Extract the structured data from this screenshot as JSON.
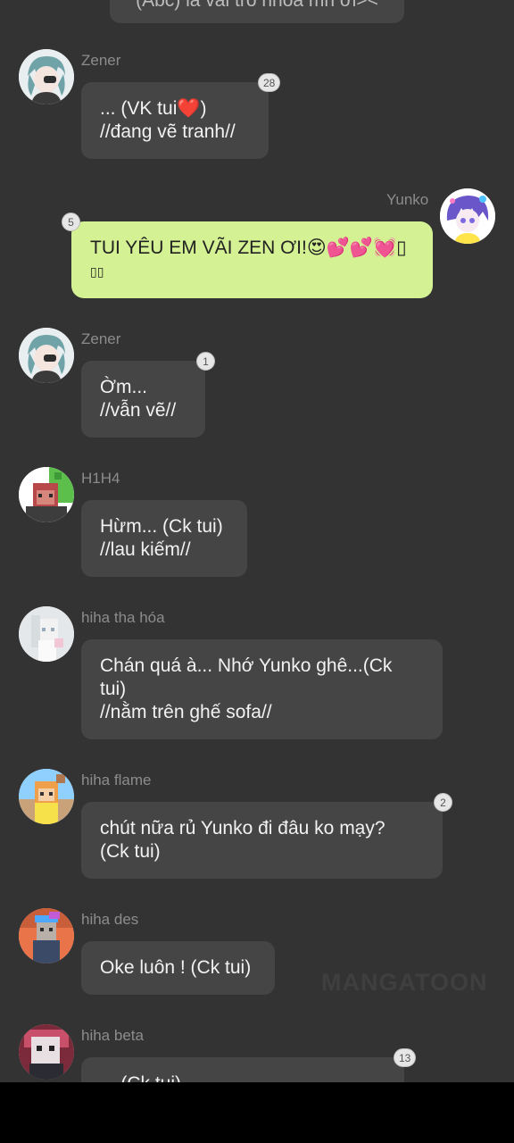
{
  "top_message": {
    "text": "(Abc) là vai trò nhóa mn ơi><"
  },
  "watermark": "MANGATOON",
  "messages": [
    {
      "sender": "Zener",
      "lines": [
        "... (VK tui❤️)",
        "//đang vẽ tranh//"
      ],
      "badge": "28",
      "mine": false
    },
    {
      "sender": "Yunko",
      "lines": [
        "TUI YÊU EM VÃI ZEN ƠI!😍💕💕💓▯",
        "▯▯"
      ],
      "badge": "5",
      "mine": true
    },
    {
      "sender": "Zener",
      "lines": [
        "Ờm...",
        "//vẫn vẽ//"
      ],
      "badge": "1",
      "mine": false
    },
    {
      "sender": "H1H4",
      "lines": [
        "Hừm... (Ck tui)",
        "//lau kiếm//"
      ],
      "badge": "",
      "mine": false
    },
    {
      "sender": "hiha tha hóa",
      "lines": [
        "Chán quá à... Nhớ Yunko ghê...(Ck",
        "tui)",
        "//nằm trên ghế sofa//"
      ],
      "badge": "",
      "mine": false
    },
    {
      "sender": "hiha flame",
      "lines": [
        "chút nữa rủ Yunko đi đâu ko mạy?",
        "(Ck tui)"
      ],
      "badge": "2",
      "mine": false
    },
    {
      "sender": "hiha des",
      "lines": [
        "Oke luôn ! (Ck tui)"
      ],
      "badge": "",
      "mine": false
    },
    {
      "sender": "hiha beta",
      "lines": [
        "... (Ck tui)"
      ],
      "badge": "13",
      "mine": false
    }
  ]
}
